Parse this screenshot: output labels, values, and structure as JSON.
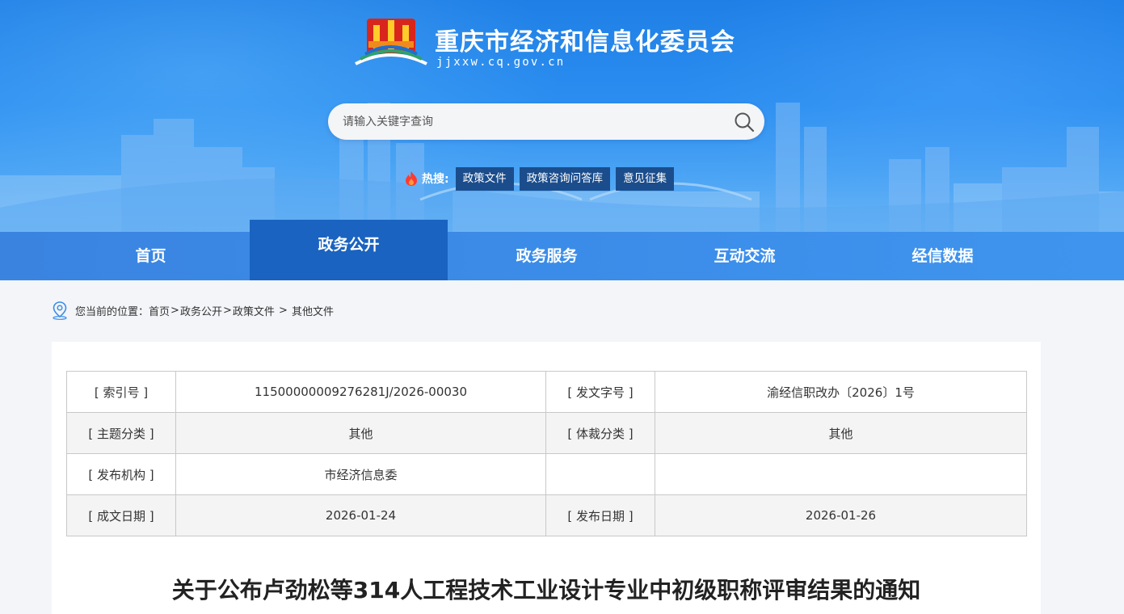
{
  "header": {
    "site_title": "重庆市经济和信息化委员会",
    "site_url": "jjxxw.cq.gov.cn",
    "logo_icon": "government-emblem-icon"
  },
  "search": {
    "placeholder": "请输入关键字查询",
    "value": "",
    "icon": "search-icon"
  },
  "hot_search": {
    "label": "热搜:",
    "icon": "flame-icon",
    "tags": [
      "政策文件",
      "政策咨询问答库",
      "意见征集"
    ]
  },
  "nav": {
    "items": [
      "首页",
      "政务公开",
      "政务服务",
      "互动交流",
      "经信数据"
    ],
    "active": "政务公开"
  },
  "breadcrumb": {
    "prefix": "您当前的位置：",
    "items": [
      "首页",
      "政务公开",
      "政策文件",
      "其他文件"
    ],
    "icon": "location-pin-icon"
  },
  "meta_table": {
    "rows": [
      [
        "[ 索引号 ]",
        "11500000009276281J/2026-00030",
        "[ 发文字号 ]",
        "渝经信职改办〔2026〕1号"
      ],
      [
        "[ 主题分类 ]",
        "其他",
        "[ 体裁分类 ]",
        "其他"
      ],
      [
        "[ 发布机构 ]",
        "市经济信息委",
        "",
        ""
      ],
      [
        "[ 成文日期 ]",
        "2026-01-24",
        "[ 发布日期 ]",
        "2026-01-26"
      ]
    ]
  },
  "document": {
    "title": "关于公布卢劲松等314人工程技术工业设计专业中初级职称评审结果的通知"
  },
  "colors": {
    "banner_blue": "#2b8ef0",
    "nav_active": "#1a63c0",
    "hot_tag_bg": "#1b4d8c"
  }
}
